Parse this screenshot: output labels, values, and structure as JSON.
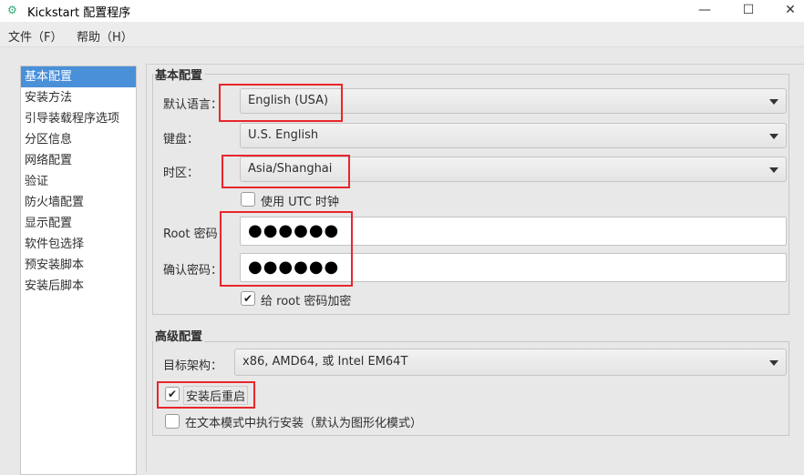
{
  "window": {
    "title": "Kickstart 配置程序",
    "minimize": "—",
    "maximize": "☐",
    "close": "✕"
  },
  "menu": [
    "文件（F）",
    "帮助（H）"
  ],
  "sidebar": {
    "items": [
      "基本配置",
      "安装方法",
      "引导装载程序选项",
      "分区信息",
      "网络配置",
      "验证",
      "防火墙配置",
      "显示配置",
      "软件包选择",
      "预安装脚本",
      "安装后脚本"
    ],
    "selected": 0
  },
  "basic": {
    "title": "基本配置",
    "language_label": "默认语言：",
    "language_value": "English (USA)",
    "keyboard_label": "键盘：",
    "keyboard_value": "U.S. English",
    "timezone_label": "时区：",
    "timezone_value": "Asia/Shanghai",
    "utc_label": "使用 UTC 时钟",
    "utc_checked": false,
    "root_pw_label": "Root 密码",
    "root_pw_value": "●●●●●●",
    "confirm_pw_label": "确认密码：",
    "confirm_pw_value": "●●●●●●",
    "encrypt_label": "给 root 密码加密",
    "encrypt_checked": true
  },
  "advanced": {
    "title": "高级配置",
    "arch_label": "目标架构：",
    "arch_value": "x86, AMD64, 或 Intel EM64T",
    "reboot_label": "安装后重启",
    "reboot_checked": true,
    "textmode_label": "在文本模式中执行安装（默认为图形化模式）",
    "textmode_checked": false
  },
  "check_glyph": "✔"
}
